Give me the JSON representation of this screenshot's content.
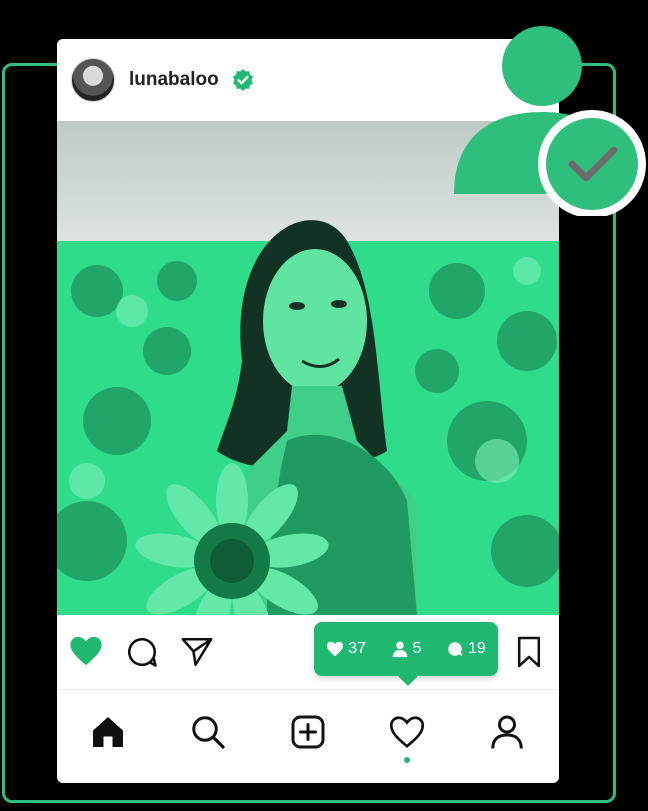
{
  "post": {
    "username": "lunabaloo"
  },
  "stats": {
    "likes": "37",
    "followers": "5",
    "comments": "19"
  },
  "colors": {
    "accent": "#1fb871",
    "frame": "#2fbf7c"
  },
  "icons": [
    "verified-icon",
    "heart-icon",
    "comment-icon",
    "share-icon",
    "bookmark-icon",
    "home-icon",
    "search-icon",
    "add-post-icon",
    "activity-icon",
    "profile-icon",
    "follow-verified-icon"
  ]
}
